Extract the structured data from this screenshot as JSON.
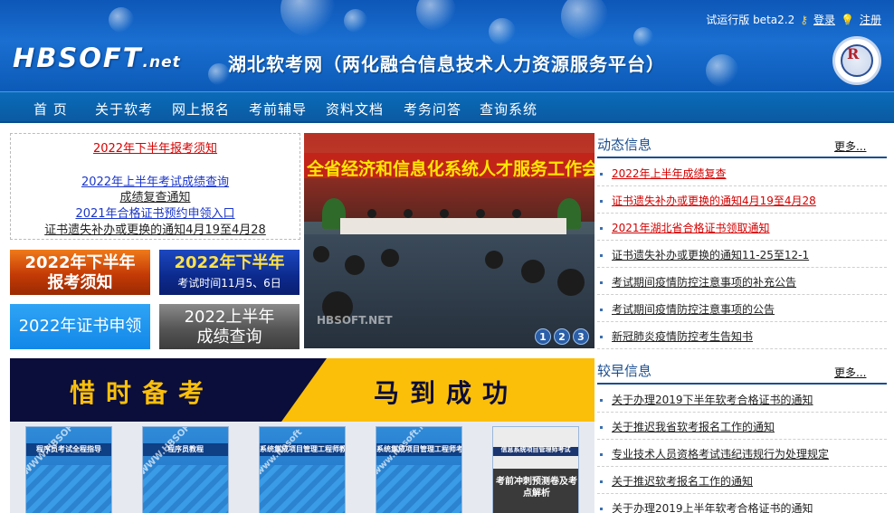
{
  "header": {
    "logo_main": "HBSOFT",
    "logo_suffix": ".net",
    "site_title": "湖北软考网（两化融合信息技术人力资源服务平台）",
    "version_label": "试运行版 beta2.2",
    "login": "登录",
    "register": "注册",
    "seal_mark": "R"
  },
  "nav": [
    "首 页",
    "关于软考",
    "网上报名",
    "考前辅导",
    "资料文档",
    "考务问答",
    "查询系统"
  ],
  "notice_box": {
    "top_link": "2022年下半年报考须知",
    "links": [
      "2022年上半年考试成绩查询",
      "成绩复查通知",
      "2021年合格证书预约申领入口",
      "证书遗失补办或更换的通知4月19至4月28"
    ]
  },
  "buttons": {
    "notice": {
      "line1": "2022年下半年",
      "line2": "报考须知"
    },
    "time": {
      "line1": "2022年下半年",
      "line2": "考试时间11月5、6日"
    },
    "cert": {
      "line1": "2022年证书申领"
    },
    "score": {
      "line1": "2022上半年",
      "line2": "成绩查询"
    }
  },
  "slideshow": {
    "banner": "全省经济和信息化系统人才服务工作会议",
    "watermark": "HBSOFT.NET",
    "pages": [
      "1",
      "2",
      "3"
    ]
  },
  "slogan": {
    "left": "惜时备考",
    "right": "马到成功"
  },
  "books": [
    {
      "title": "程序员考试全程指导",
      "watermark": "WWW.HBSOFT"
    },
    {
      "title": "程序员教程",
      "watermark": "WWW.HBSOFT.NE"
    },
    {
      "title": "系统集成项目管理工程师教程",
      "watermark": "www.hbsoft"
    },
    {
      "title": "系统集成项目管理工程师考试全程指导",
      "watermark": "www.hbsoft.ne"
    },
    {
      "title": "信息系统项目管理师考试",
      "subtitle": "考前冲刺预测卷及考点解析"
    }
  ],
  "dynamic_news": {
    "title": "动态信息",
    "more": "更多...",
    "items": [
      {
        "text": "2022年上半年成绩复查",
        "red": true
      },
      {
        "text": "证书遗失补办或更换的通知4月19至4月28",
        "red": true
      },
      {
        "text": "2021年湖北省合格证书领取通知",
        "red": true
      },
      {
        "text": "证书遗失补办或更换的通知11-25至12-1",
        "red": false
      },
      {
        "text": "考试期间疫情防控注意事项的补充公告",
        "red": false
      },
      {
        "text": "考试期间疫情防控注意事项的公告",
        "red": false
      },
      {
        "text": "新冠肺炎疫情防控考生告知书",
        "red": false
      }
    ]
  },
  "earlier_news": {
    "title": "较早信息",
    "more": "更多...",
    "items": [
      {
        "text": "关于办理2019下半年软考合格证书的通知"
      },
      {
        "text": "关于推迟我省软考报名工作的通知"
      },
      {
        "text": "专业技术人员资格考试违纪违规行为处理规定"
      },
      {
        "text": "关于推迟软考报名工作的通知"
      },
      {
        "text": "关于办理2019上半年软考合格证书的通知"
      }
    ]
  },
  "colors": {
    "header_blue": "#1a6fd0",
    "nav_blue": "#0b5aa1",
    "accent_red": "#d40000",
    "section_blue": "#1b4e8f",
    "slogan_yellow": "#fbbf0a",
    "slogan_navy": "#0b0d3a"
  }
}
